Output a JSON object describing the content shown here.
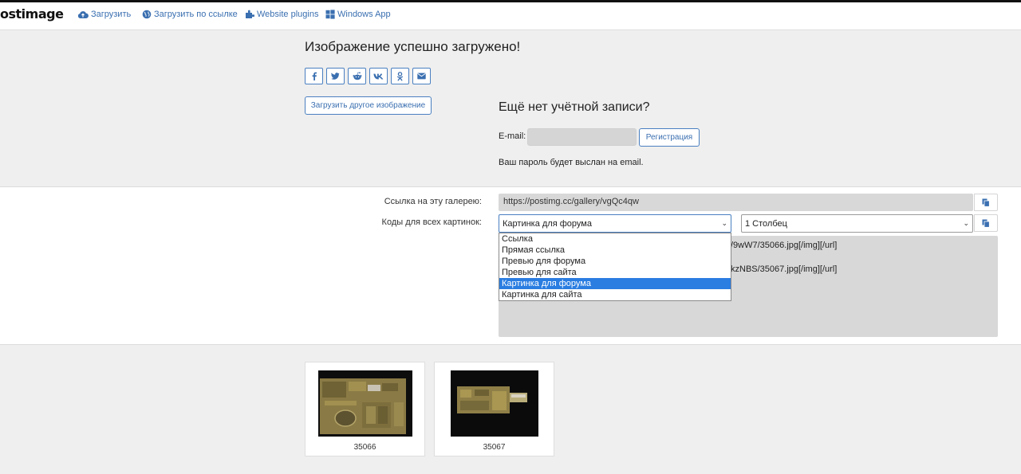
{
  "brand": {
    "logo_text": "ostimage"
  },
  "nav": {
    "upload": "Загрузить",
    "upload_by_link": "Загрузить по ссылке",
    "website_plugins": "Website plugins",
    "windows_app": "Windows App"
  },
  "upload_result": {
    "title": "Изображение успешно загружено!",
    "share_buttons": [
      "facebook-icon",
      "twitter-icon",
      "reddit-icon",
      "vk-icon",
      "odnoklassniki-icon",
      "email-icon"
    ],
    "upload_another_label": "Загрузить другое изображение"
  },
  "account": {
    "title": "Ещё нет учётной записи?",
    "email_label": "E-mail:",
    "email_value": "",
    "register_label": "Регистрация",
    "password_note": "Ваш пароль будет выслан на email."
  },
  "codes": {
    "gallery_label": "Ссылка на эту галерею:",
    "gallery_url": "https://postimg.cc/gallery/vgQc4qw",
    "codes_label": "Коды для всех картинок:",
    "code_type_selected": "Картинка для форума",
    "columns_selected": "1 Столбец",
    "code_lines": [
      "/9wW7/35066.jpg[/img][/url]",
      "kzNBS/35067.jpg[/img][/url]"
    ],
    "dropdown_options": [
      "Ссылка",
      "Прямая ссылка",
      "Превью для форума",
      "Превью для сайта",
      "Картинка для форума",
      "Картинка для сайта"
    ],
    "dropdown_selected_index": 4
  },
  "thumbnails": [
    {
      "caption": "35066"
    },
    {
      "caption": "35067"
    }
  ],
  "colors": {
    "accent": "#3a6fb0",
    "dropdown_highlight": "#2a7de1",
    "page_bg": "#efefef",
    "field_bg": "#d8d8d8"
  }
}
